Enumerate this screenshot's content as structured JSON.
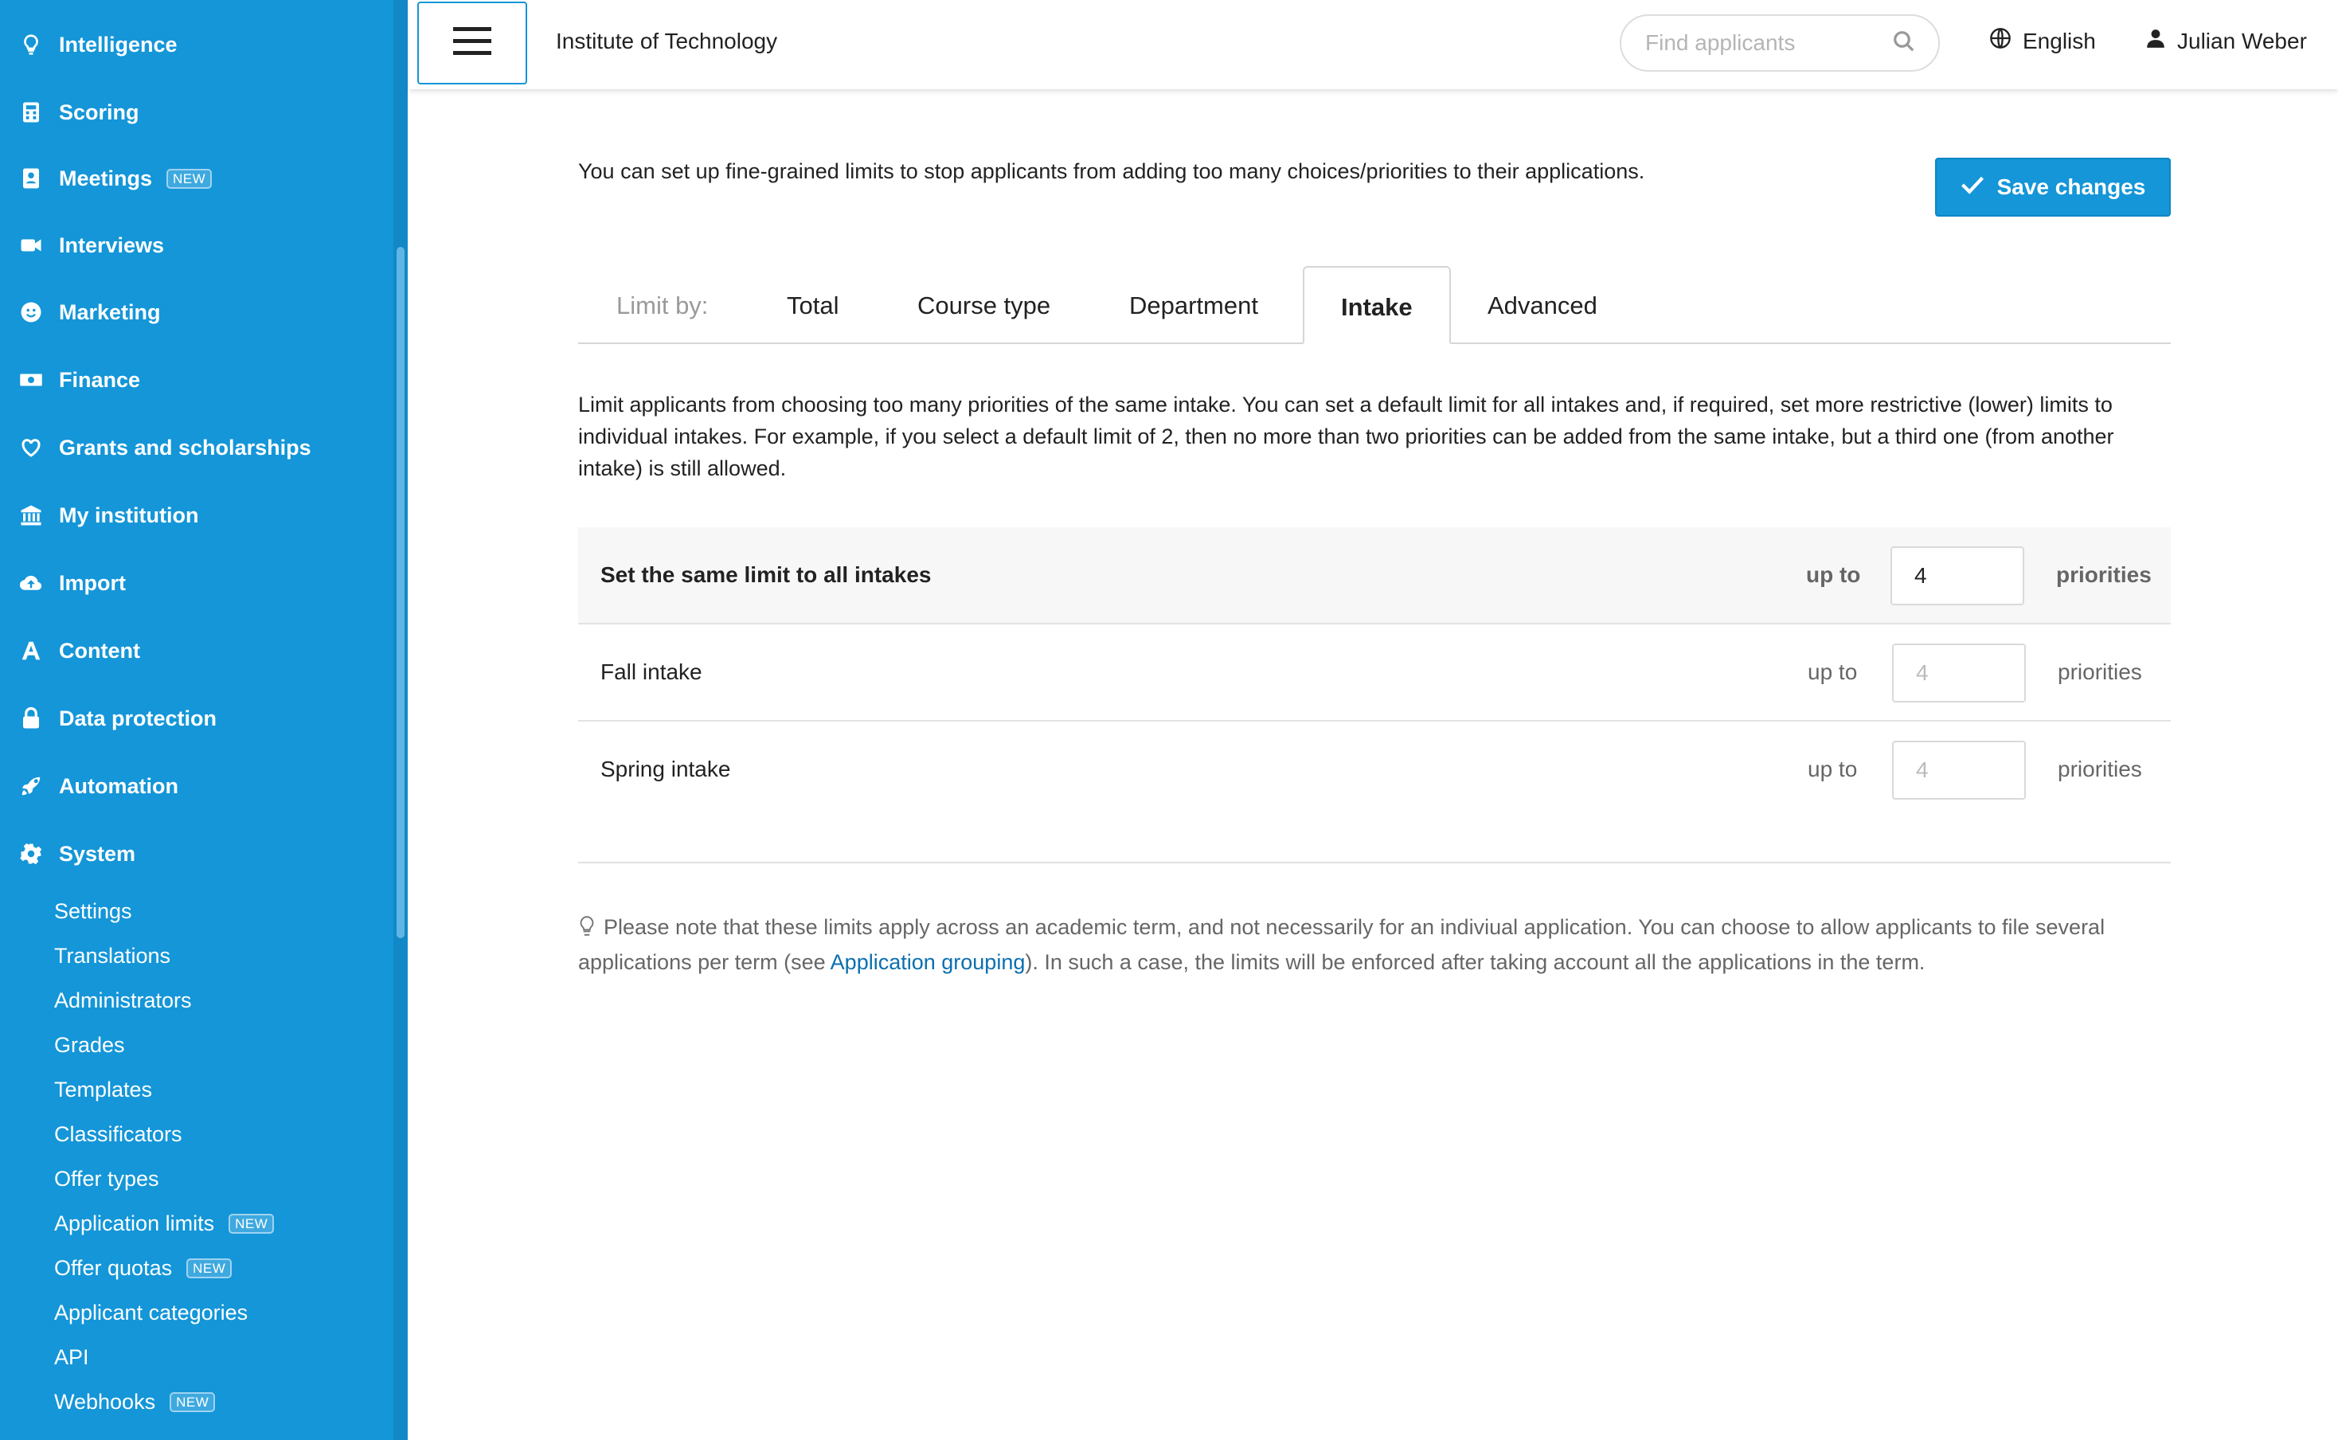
{
  "sidebar": {
    "items": [
      {
        "label": "Intelligence",
        "icon": "lightbulb-icon"
      },
      {
        "label": "Scoring",
        "icon": "calculator-icon"
      },
      {
        "label": "Meetings",
        "icon": "address-book-icon",
        "badge": "NEW"
      },
      {
        "label": "Interviews",
        "icon": "video-camera-icon"
      },
      {
        "label": "Marketing",
        "icon": "smiley-icon"
      },
      {
        "label": "Finance",
        "icon": "money-bill-icon"
      },
      {
        "label": "Grants and scholarships",
        "icon": "heart-icon"
      },
      {
        "label": "My institution",
        "icon": "institution-icon"
      },
      {
        "label": "Import",
        "icon": "cloud-upload-icon"
      },
      {
        "label": "Content",
        "icon": "font-a-icon"
      },
      {
        "label": "Data protection",
        "icon": "lock-icon"
      },
      {
        "label": "Automation",
        "icon": "rocket-icon"
      },
      {
        "label": "System",
        "icon": "gear-icon"
      }
    ],
    "system_sub": [
      {
        "label": "Settings"
      },
      {
        "label": "Translations"
      },
      {
        "label": "Administrators"
      },
      {
        "label": "Grades"
      },
      {
        "label": "Templates"
      },
      {
        "label": "Classificators"
      },
      {
        "label": "Offer types"
      },
      {
        "label": "Application limits",
        "badge": "NEW"
      },
      {
        "label": "Offer quotas",
        "badge": "NEW"
      },
      {
        "label": "Applicant categories"
      },
      {
        "label": "API"
      },
      {
        "label": "Webhooks",
        "badge": "NEW"
      }
    ]
  },
  "header": {
    "institution": "Institute of Technology",
    "search_placeholder": "Find applicants",
    "language": "English",
    "user": "Julian Weber"
  },
  "main": {
    "intro": "You can set up fine-grained limits to stop applicants from adding too many choices/priorities to their applications.",
    "save_label": "Save changes",
    "tabs_label": "Limit by:",
    "tabs": [
      {
        "label": "Total"
      },
      {
        "label": "Course type"
      },
      {
        "label": "Department"
      },
      {
        "label": "Intake",
        "active": true
      },
      {
        "label": "Advanced"
      }
    ],
    "description": "Limit applicants from choosing too many priorities of the same intake. You can set a default limit for all intakes and, if required, set more restrictive (lower) limits to individual intakes. For example, if you select a default limit of 2, then no more than two priorities can be added from the same intake, but a third one (from another intake) is still allowed.",
    "rows": [
      {
        "name": "Set the same limit to all intakes",
        "upto": "up to",
        "value": "4",
        "placeholder": "",
        "unit": "priorities"
      },
      {
        "name": "Fall intake",
        "upto": "up to",
        "value": "",
        "placeholder": "4",
        "unit": "priorities"
      },
      {
        "name": "Spring intake",
        "upto": "up to",
        "value": "",
        "placeholder": "4",
        "unit": "priorities"
      }
    ],
    "note_before": "Please note that these limits apply across an academic term, and not necessarily for an indiviual application. You can choose to allow applicants to file several applications per term (see ",
    "note_link": "Application grouping",
    "note_after": "). In such a case, the limits will be enforced after taking account all the applications in the term."
  },
  "colors": {
    "sidebar": "#1496d8",
    "accent": "#1496d8",
    "link": "#0b6fb0"
  }
}
